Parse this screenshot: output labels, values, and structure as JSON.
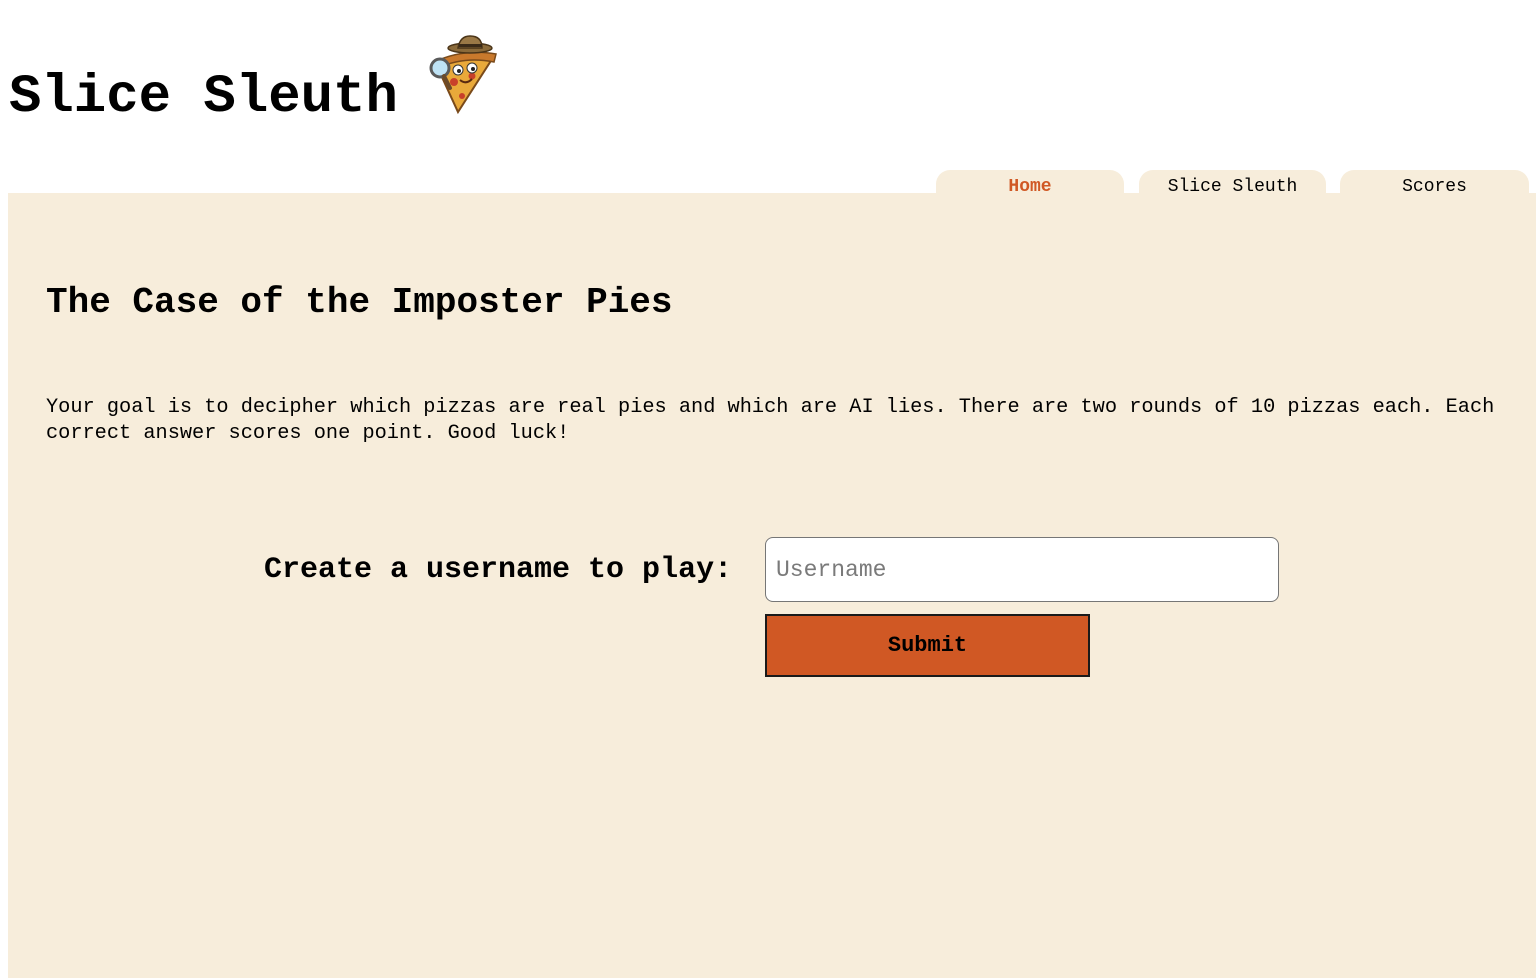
{
  "header": {
    "site_title": "Slice Sleuth",
    "logo_icon": "pizza-detective-icon"
  },
  "nav": {
    "tabs": [
      {
        "label": "Home",
        "active": true
      },
      {
        "label": "Slice Sleuth",
        "active": false
      },
      {
        "label": "Scores",
        "active": false
      }
    ]
  },
  "main": {
    "title": "The Case of the Imposter Pies",
    "intro": "Your goal is to decipher which pizzas are real pies and which are AI lies. There are two rounds of 10 pizzas each. Each correct answer scores one point. Good luck!",
    "form": {
      "label": "Create a username to play:",
      "username_placeholder": "Username",
      "username_value": "",
      "submit_label": "Submit"
    }
  },
  "colors": {
    "accent": "#d05824",
    "panel_background": "#f7eddb",
    "page_background": "#ffffff"
  }
}
